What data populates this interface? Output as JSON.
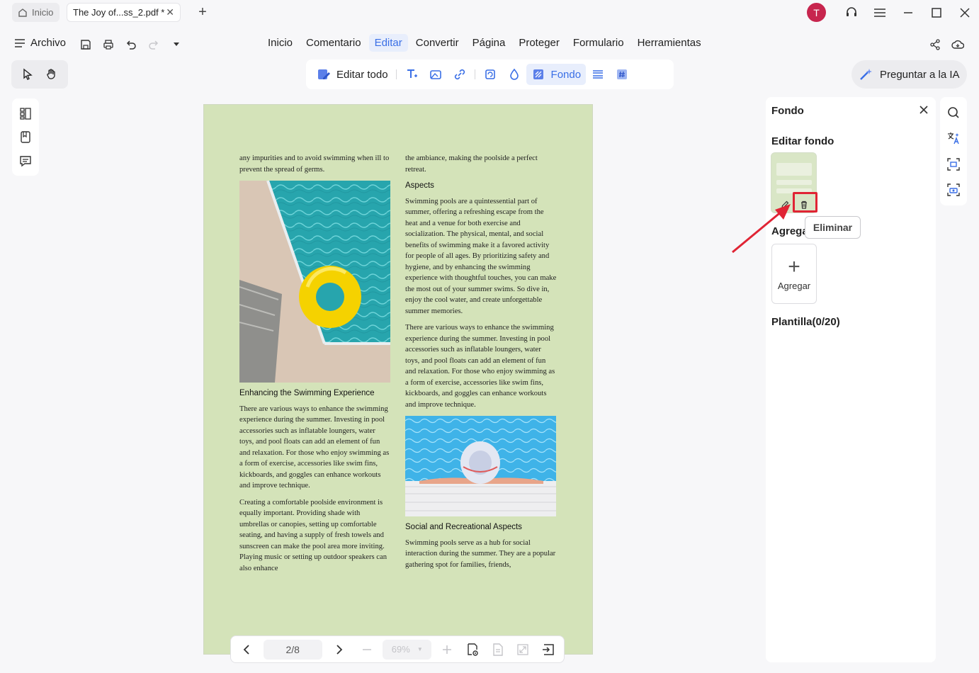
{
  "titlebar": {
    "home_tab": "Inicio",
    "doc_tab": "The Joy of...ss_2.pdf *",
    "avatar_letter": "T"
  },
  "menu": {
    "archivo": "Archivo",
    "items": [
      "Inicio",
      "Comentario",
      "Editar",
      "Convertir",
      "Página",
      "Proteger",
      "Formulario",
      "Herramientas"
    ],
    "active": "Editar"
  },
  "edit_toolbar": {
    "edit_all": "Editar todo",
    "fondo": "Fondo"
  },
  "ai_button": "Preguntar a la IA",
  "document": {
    "left_intro": "any impurities and to avoid swimming when ill to prevent the spread of germs.",
    "left_heading": "Enhancing the Swimming Experience",
    "left_p1": "There are various ways to enhance the swimming experience during the summer. Investing in pool accessories such as inflatable loungers, water toys, and pool floats can add an element of fun and relaxation. For those who enjoy swimming as a form of exercise, accessories like swim fins, kickboards, and goggles can enhance workouts and improve technique.",
    "left_p2": "Creating a comfortable poolside environment is equally important. Providing shade with umbrellas or canopies, setting up comfortable seating, and having a supply of fresh towels and sunscreen can make the pool area more inviting. Playing music or setting up outdoor speakers can also enhance",
    "right_intro": "the ambiance, making the poolside a perfect retreat.",
    "right_heading1": "Aspects",
    "right_p1": "Swimming pools are a quintessential part of summer, offering a refreshing escape from the heat and a venue for both exercise and socialization. The physical, mental, and social benefits of swimming make it a favored activity for people of all ages. By prioritizing safety and hygiene, and by enhancing the swimming experience with thoughtful touches, you can make the most out of your summer swims. So dive in, enjoy the cool water, and create unforgettable summer memories.",
    "right_p2": "There are various ways to enhance the swimming experience during the summer. Investing in pool accessories such as inflatable loungers, water toys, and pool floats can add an element of fun and relaxation. For those who enjoy swimming as a form of exercise, accessories like swim fins, kickboards, and goggles can enhance workouts and improve technique.",
    "right_heading2": "Social and Recreational Aspects",
    "right_p3": "Swimming pools serve as a hub for social interaction during the summer. They are a popular gathering spot for families, friends,"
  },
  "bottom_nav": {
    "page": "2/8",
    "zoom": "69%"
  },
  "panel": {
    "title": "Fondo",
    "edit_section": "Editar fondo",
    "tooltip": "Eliminar",
    "add_section": "Agregar",
    "add_label": "Agregar",
    "template_section": "Plantilla(0/20)"
  },
  "colors": {
    "accent": "#3a6fe6",
    "page_background": "#d4e3b9",
    "highlight": "#e02434"
  }
}
